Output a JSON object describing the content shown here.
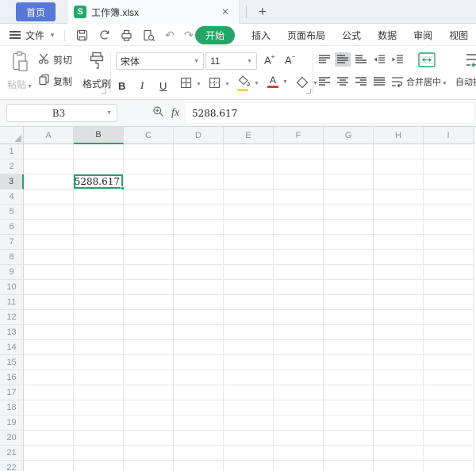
{
  "titlebar": {
    "home_label": "首页",
    "app_badge": "S",
    "tab_title": "工作簿.xlsx",
    "close_glyph": "✕",
    "new_tab_glyph": "+"
  },
  "menubar": {
    "file_label": "文件",
    "tabs": [
      {
        "label": "开始",
        "active": true
      },
      {
        "label": "插入",
        "active": false
      },
      {
        "label": "页面布局",
        "active": false
      },
      {
        "label": "公式",
        "active": false
      },
      {
        "label": "数据",
        "active": false
      },
      {
        "label": "审阅",
        "active": false
      },
      {
        "label": "视图",
        "active": false
      }
    ]
  },
  "ribbon": {
    "paste_label": "粘贴",
    "cut_label": "剪切",
    "copy_label": "复制",
    "format_painter_label": "格式刷",
    "font_name": "宋体",
    "font_size": "11",
    "bold_label": "B",
    "italic_label": "I",
    "underline_label": "U",
    "merge_center_label": "合并居中",
    "wrap_text_label": "自动换行"
  },
  "formula_bar": {
    "name_box_value": "B3",
    "fx_label": "fx",
    "formula_value": "5288.617"
  },
  "grid": {
    "columns": [
      "A",
      "B",
      "C",
      "D",
      "E",
      "F",
      "G",
      "H",
      "I"
    ],
    "row_count": 22,
    "selected_cell": {
      "column": "B",
      "row": 3,
      "value": "5288.617"
    }
  },
  "colors": {
    "accent_green": "#21a666",
    "home_button_blue": "#5878d8",
    "fill_swatch_yellow": "#f2d341",
    "font_color_swatch_red": "#e03c3c"
  }
}
